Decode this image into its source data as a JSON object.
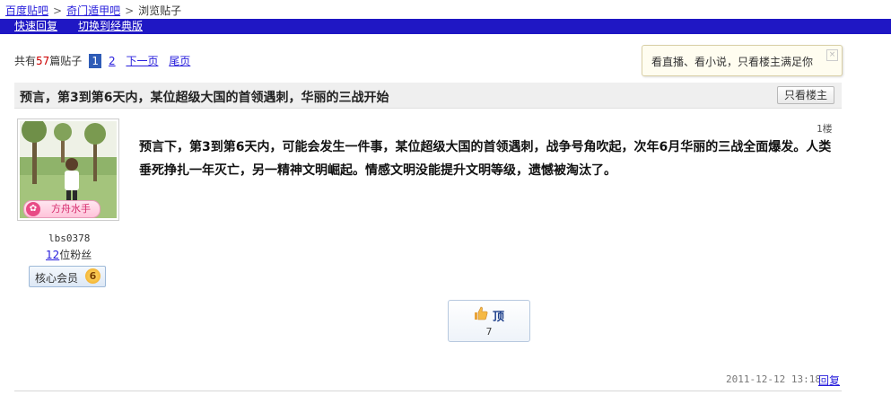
{
  "breadcrumb": {
    "items": [
      "百度贴吧",
      "奇门遁甲吧",
      "浏览贴子"
    ]
  },
  "toolbar": {
    "quick_reply": "快速回复",
    "switch_classic": "切换到经典版"
  },
  "pager": {
    "prefix": "共有",
    "count": "57",
    "suffix": "篇贴子",
    "current_page": "1",
    "other_page": "2",
    "next": "下一页",
    "last": "尾页"
  },
  "tooltip": {
    "text": "看直播、看小说，只看楼主满足你",
    "close": "×"
  },
  "thread": {
    "title": "预言，第3到第6天内，某位超级大国的首领遇刺，华丽的三战开始",
    "only_author": "只看楼主"
  },
  "post": {
    "floor": "1楼",
    "author": {
      "name": "lbs0378",
      "fans_count": "12",
      "fans_label": "位粉丝",
      "badge_image_text": "方舟水手",
      "member_label": "核心会员",
      "level": "6"
    },
    "content": "预言下，第3到第6天内，可能会发生一件事，某位超级大国的首领遇刺，战争号角吹起，次年6月华丽的三战全面爆发。人类垂死挣扎一年灭亡，另一精神文明崛起。情感文明没能提升文明等级，遗憾被淘汰了。",
    "ding_label": "顶",
    "ding_count": "7",
    "datetime": "2011-12-12  13:18",
    "reply_label": "回复"
  },
  "colors": {
    "header_bar": "#1f17c4",
    "link": "#261cdc",
    "count_red": "#cc0000",
    "current_page_bg": "#2f5cb7"
  }
}
